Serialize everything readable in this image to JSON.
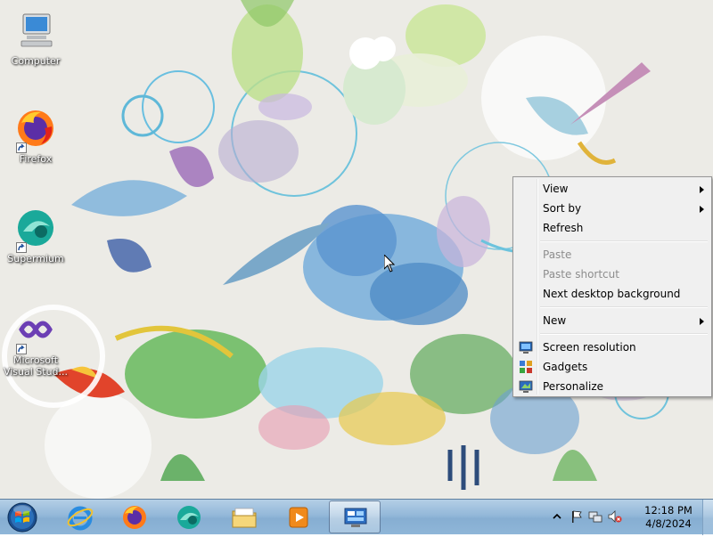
{
  "desktop": {
    "icons": [
      {
        "label": "Computer",
        "icon": "computer-icon",
        "shortcut": false
      },
      {
        "label": "Firefox",
        "icon": "firefox-icon",
        "shortcut": true
      },
      {
        "label": "Supermium",
        "icon": "supermium-icon",
        "shortcut": true
      },
      {
        "label": "Microsoft Visual Stud...",
        "icon": "visual-studio-icon",
        "shortcut": true
      }
    ]
  },
  "context_menu": {
    "items": [
      {
        "label": "View",
        "submenu": true,
        "enabled": true
      },
      {
        "label": "Sort by",
        "submenu": true,
        "enabled": true
      },
      {
        "label": "Refresh",
        "submenu": false,
        "enabled": true
      },
      {
        "label": "Paste",
        "submenu": false,
        "enabled": false
      },
      {
        "label": "Paste shortcut",
        "submenu": false,
        "enabled": false
      },
      {
        "label": "Next desktop background",
        "submenu": false,
        "enabled": true
      },
      {
        "label": "New",
        "submenu": true,
        "enabled": true
      },
      {
        "label": "Screen resolution",
        "submenu": false,
        "enabled": true,
        "icon": "screen-resolution-icon"
      },
      {
        "label": "Gadgets",
        "submenu": false,
        "enabled": true,
        "icon": "gadgets-icon"
      },
      {
        "label": "Personalize",
        "submenu": false,
        "enabled": true,
        "icon": "personalize-icon"
      }
    ]
  },
  "taskbar": {
    "pinned": [
      "start-orb-icon",
      "internet-explorer-icon",
      "firefox-icon",
      "supermium-icon",
      "file-explorer-icon",
      "media-player-icon",
      "control-panel-icon"
    ],
    "active_button": "control-panel-icon",
    "clock": {
      "time": "12:18 PM",
      "date": "4/8/2024"
    }
  },
  "colors": {
    "taskbar_top": "#b4cfe6",
    "taskbar_bottom": "#86aed2",
    "menu_bg": "#f0f0f0",
    "menu_border": "#979797",
    "disabled_text": "#8d8d8d"
  }
}
